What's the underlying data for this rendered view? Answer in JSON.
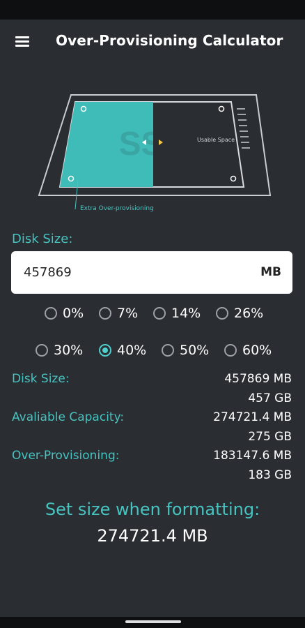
{
  "app": {
    "title": "Over-Provisioning Calculator"
  },
  "illustration": {
    "ssd_text": "SSD",
    "usable_label": "Usable Space",
    "extra_label": "Extra Over-provisioning"
  },
  "input": {
    "label": "Disk Size:",
    "value": "457869",
    "unit": "MB"
  },
  "options": {
    "row1": [
      "0%",
      "7%",
      "14%",
      "26%"
    ],
    "row2": [
      "30%",
      "40%",
      "50%",
      "60%"
    ],
    "selected": "40%"
  },
  "stats": {
    "disk_size_label": "Disk Size:",
    "disk_size_mb": "457869 MB",
    "disk_size_gb": "457 GB",
    "available_label": "Avaliable Capacity:",
    "available_mb": "274721.4 MB",
    "available_gb": "275 GB",
    "op_label": "Over-Provisioning:",
    "op_mb": "183147.6 MB",
    "op_gb": "183 GB"
  },
  "format": {
    "title": "Set size when formatting:",
    "value": "274721.4 MB"
  },
  "colors": {
    "accent": "#46c4c1",
    "background": "#2a2d31",
    "panel_fill": "#3fbbb8"
  },
  "icons": {
    "menu": "hamburger-menu-icon"
  }
}
